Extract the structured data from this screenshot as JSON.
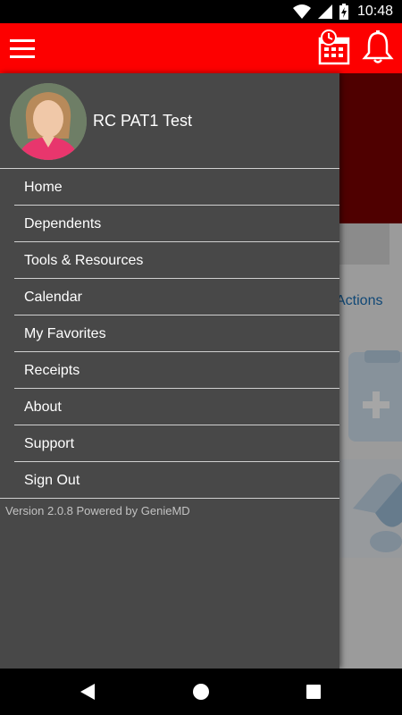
{
  "status_bar": {
    "time": "10:48",
    "icons": [
      "wifi-icon",
      "signal-icon",
      "battery-charging-icon"
    ]
  },
  "app_bar": {
    "background_color": "#fd0000",
    "menu_icon": "hamburger-menu-icon",
    "calendar_icon": "calendar-history-icon",
    "bell_icon": "bell-icon"
  },
  "background": {
    "actions_text": "Actions"
  },
  "drawer": {
    "background_color": "#484848",
    "user": {
      "name": "RC PAT1 Test",
      "avatar_icon": "user-avatar"
    },
    "items": [
      {
        "label": "Home"
      },
      {
        "label": "Dependents"
      },
      {
        "label": "Tools & Resources"
      },
      {
        "label": "Calendar"
      },
      {
        "label": "My Favorites"
      },
      {
        "label": "Receipts"
      },
      {
        "label": "About"
      },
      {
        "label": "Support"
      },
      {
        "label": "Sign Out"
      }
    ],
    "version": "Version 2.0.8 Powered by GenieMD"
  },
  "nav_bar": {
    "back_icon": "back-triangle-icon",
    "home_icon": "home-circle-icon",
    "recents_icon": "recents-square-icon"
  }
}
